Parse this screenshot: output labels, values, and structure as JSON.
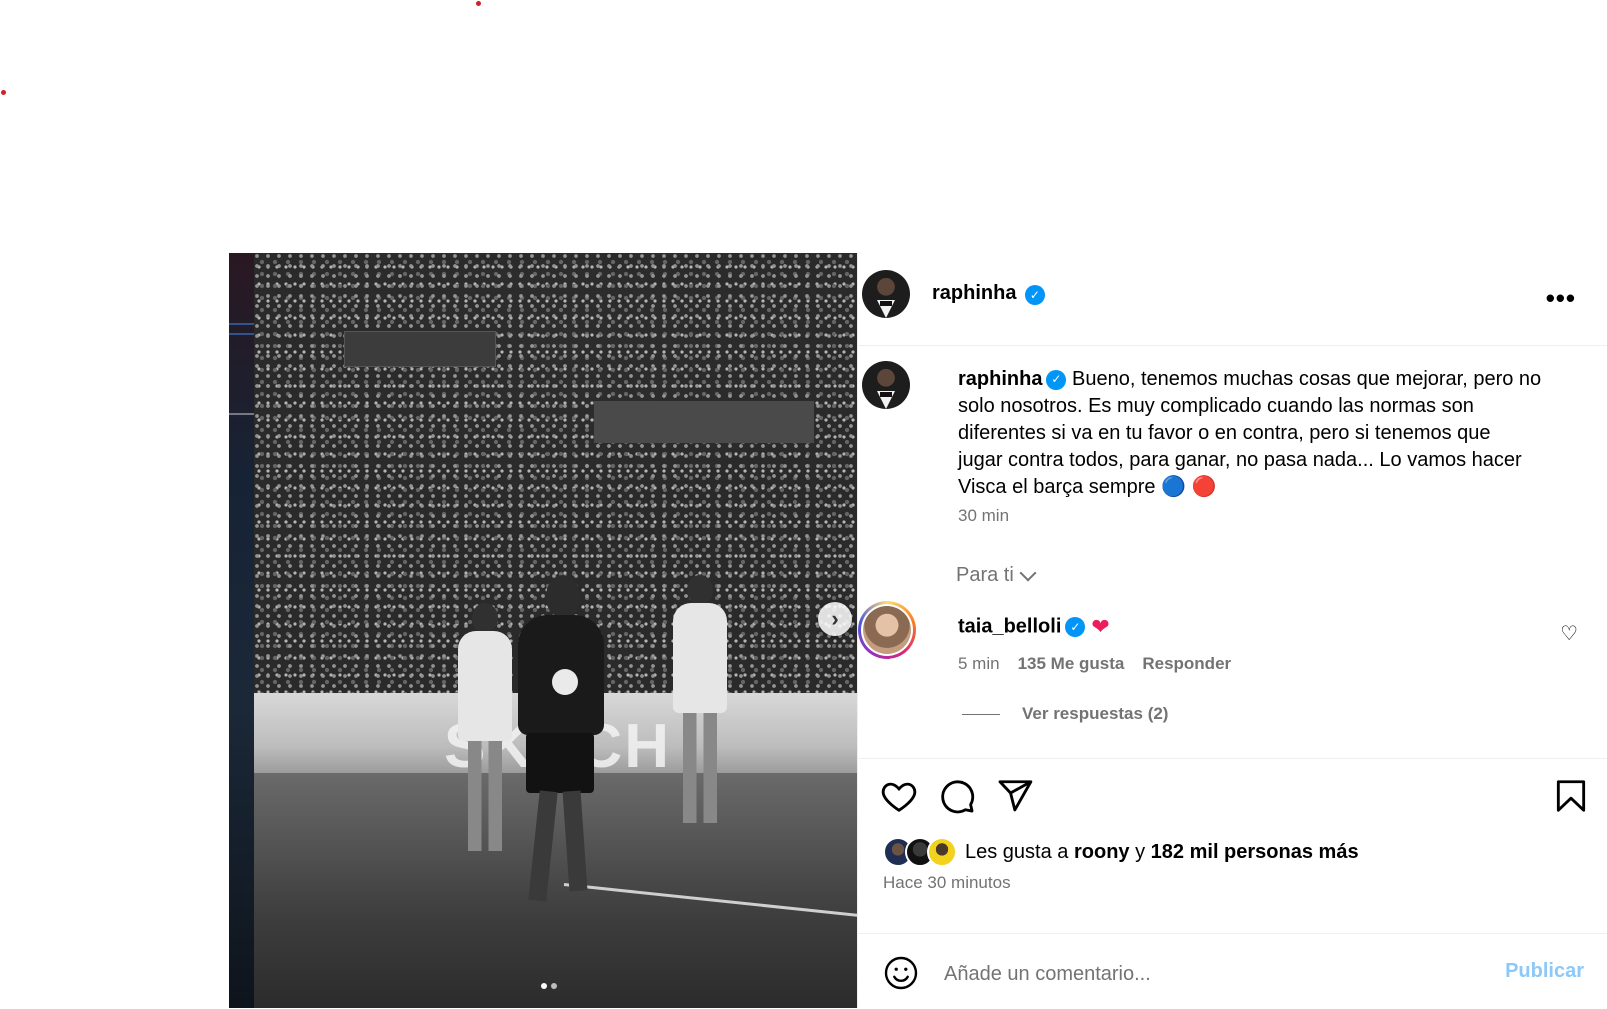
{
  "post": {
    "author": "raphinha",
    "caption_author": "raphinha",
    "caption_lines": [
      "Bueno, tenemos muchas cosas que mejorar, pero no",
      "solo nosotros. Es muy complicado cuando las normas son",
      "diferentes si va en tu favor o en contra, pero si tenemos que",
      "jugar contra todos, para ganar, no pasa nada... Lo vamos hacer",
      "Visca el barça sempre"
    ],
    "caption_emoji": "🔵 🔴",
    "caption_time": "30 min",
    "image_text": "SKECH"
  },
  "comments": {
    "filter_label": "Para ti",
    "items": [
      {
        "user": "taia_belloli",
        "emoji": "❤",
        "time": "5 min",
        "likes": "135 Me gusta",
        "reply_label": "Responder",
        "view_replies": "Ver respuestas (2)"
      }
    ]
  },
  "likes": {
    "prefix": "Les gusta a",
    "user": "roony",
    "conj": "y",
    "others": "182 mil personas más",
    "time_ago": "Hace 30 minutos"
  },
  "composer": {
    "placeholder": "Añade un comentario...",
    "publish_label": "Publicar"
  },
  "icons": {
    "more": "more-options-icon",
    "verified": "verified-badge-icon",
    "like": "heart-icon",
    "comment": "comment-bubble-icon",
    "share": "paper-plane-icon",
    "save": "bookmark-icon",
    "emoji": "smiley-icon",
    "next": "chevron-right-icon"
  },
  "colors": {
    "verified": "#0095f6",
    "publish": "#8cc8f8",
    "muted": "#737373",
    "heart": "#ed1c5a"
  }
}
